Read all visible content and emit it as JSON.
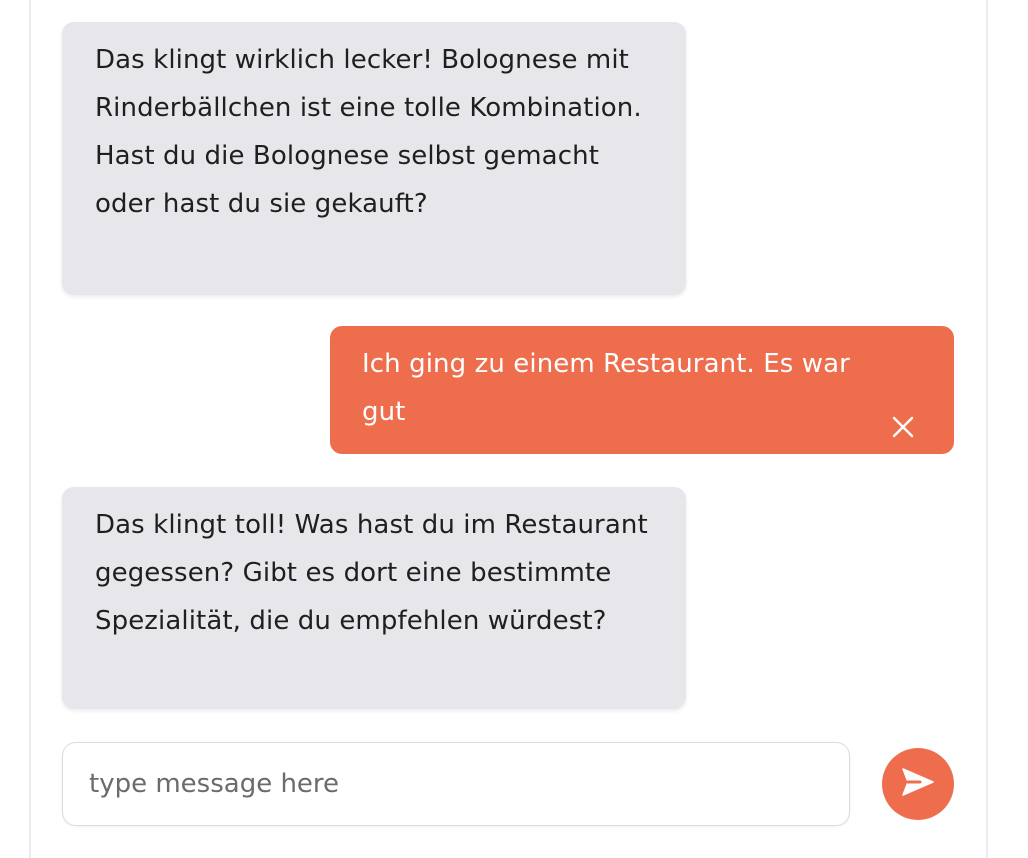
{
  "chat": {
    "messages": [
      {
        "role": "bot",
        "text": "Das klingt wirklich lecker! Bolognese mit Rinderbällchen ist eine tolle Kombination. Hast du die Bolognese selbst gemacht oder hast du sie gekauft?"
      },
      {
        "role": "user",
        "text": "Ich ging zu einem Restaurant. Es war gut"
      },
      {
        "role": "bot",
        "text": "Das klingt toll! Was hast du im Restaurant gegessen? Gibt es dort eine bestimmte Spezialität, die du empfehlen würdest?"
      }
    ]
  },
  "composer": {
    "placeholder": "type message here",
    "value": ""
  },
  "icons": {
    "close": "close-icon",
    "send": "send-icon"
  },
  "colors": {
    "accent": "#ee6d4d",
    "bot_bubble": "#e6e6eb"
  }
}
